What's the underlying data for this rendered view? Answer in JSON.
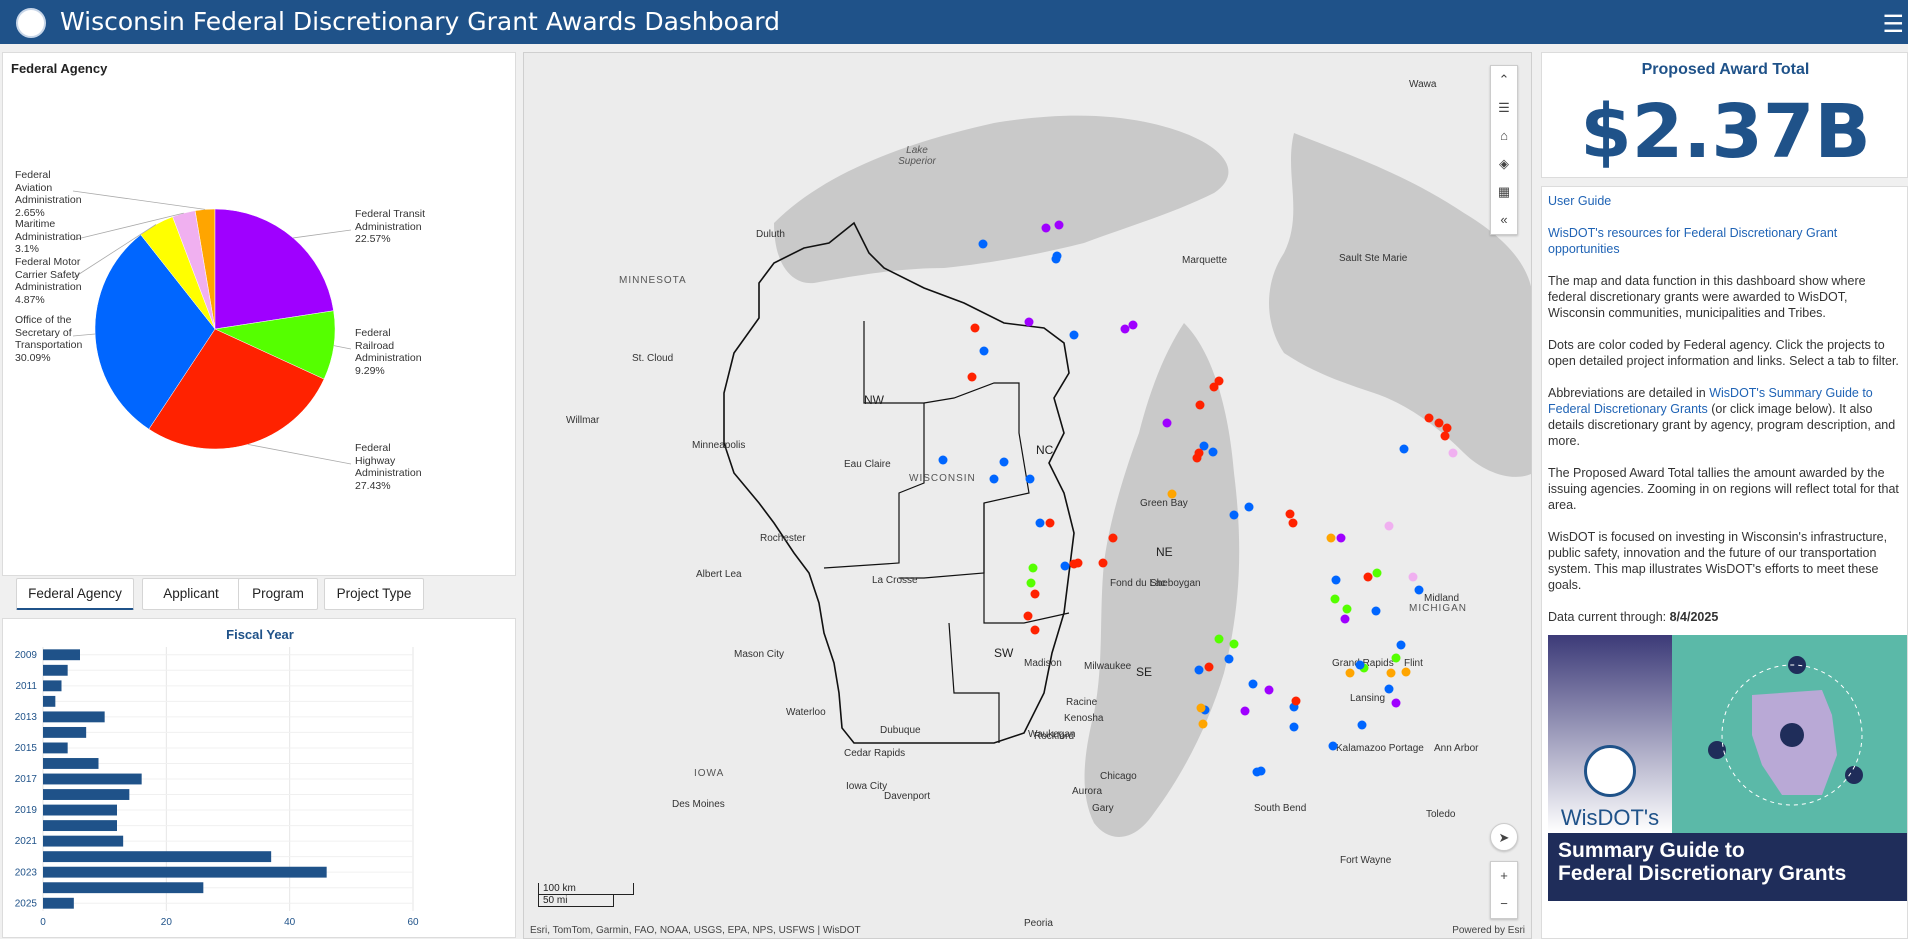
{
  "header": {
    "title": "Wisconsin Federal Discretionary Grant Awards Dashboard"
  },
  "pie": {
    "title": "Federal Agency",
    "slices": [
      {
        "name": "Federal Aviation Administration",
        "label": [
          "Federal",
          "Aviation",
          "Administration",
          "2.65%"
        ],
        "pct": 2.65,
        "color": "#ffa500"
      },
      {
        "name": "Federal Transit Administration",
        "label": [
          "Federal Transit",
          "Administration",
          "22.57%"
        ],
        "pct": 22.57,
        "color": "#9f00ff"
      },
      {
        "name": "Federal Railroad Administration",
        "label": [
          "Federal",
          "Railroad",
          "Administration",
          "9.29%"
        ],
        "pct": 9.29,
        "color": "#55ff00"
      },
      {
        "name": "Federal Highway Administration",
        "label": [
          "Federal",
          "Highway",
          "Administration",
          "27.43%"
        ],
        "pct": 27.43,
        "color": "#ff2200"
      },
      {
        "name": "Office of the Secretary of Transportation",
        "label": [
          "Office of the",
          "Secretary of",
          "Transportation",
          "30.09%"
        ],
        "pct": 30.09,
        "color": "#0066ff"
      },
      {
        "name": "Federal Motor Carrier Safety Administration",
        "label": [
          "Federal Motor",
          "Carrier Safety",
          "Administration",
          "4.87%"
        ],
        "pct": 4.87,
        "color": "#ffff00"
      },
      {
        "name": "Maritime Administration",
        "label": [
          "Maritime",
          "Administration",
          "3.1%"
        ],
        "pct": 3.1,
        "color": "#f0b0f0"
      }
    ]
  },
  "tabs": [
    "Federal Agency",
    "Applicant",
    "Program",
    "Project Type"
  ],
  "bar": {
    "title": "Fiscal Year",
    "years": [
      "2009",
      "2010",
      "2011",
      "2012",
      "2013",
      "2014",
      "2015",
      "2016",
      "2017",
      "2018",
      "2019",
      "2020",
      "2021",
      "2022",
      "2023",
      "2024",
      "2025"
    ],
    "year_labels": [
      "2009",
      "",
      "2011",
      "",
      "2013",
      "",
      "2015",
      "",
      "2017",
      "",
      "2019",
      "",
      "2021",
      "",
      "2023",
      "",
      "2025"
    ],
    "values": [
      6,
      4,
      3,
      2,
      10,
      7,
      4,
      9,
      16,
      14,
      12,
      12,
      13,
      37,
      46,
      26,
      5
    ],
    "xticks": [
      "0",
      "20",
      "40",
      "60"
    ],
    "xmax": 60,
    "color": "#1f5289"
  },
  "chart_data": {
    "type": "bar",
    "title": "Fiscal Year",
    "categories": [
      "2009",
      "2010",
      "2011",
      "2012",
      "2013",
      "2014",
      "2015",
      "2016",
      "2017",
      "2018",
      "2019",
      "2020",
      "2021",
      "2022",
      "2023",
      "2024",
      "2025"
    ],
    "values": [
      6,
      4,
      3,
      2,
      10,
      7,
      4,
      9,
      16,
      14,
      12,
      12,
      13,
      37,
      46,
      26,
      5
    ],
    "xlim": [
      0,
      60
    ],
    "orientation": "horizontal"
  },
  "map": {
    "labels": {
      "lake_superior": "Lake Superior",
      "minnesota": "MINNESOTA",
      "wisconsin": "WISCONSIN",
      "michigan": "MICHIGAN",
      "iowa": "IOWA"
    },
    "regions": [
      "NW",
      "NC",
      "NE",
      "SW",
      "SE"
    ],
    "cities": [
      "Duluth",
      "Minneapolis",
      "St. Cloud",
      "Willmar",
      "Rochester",
      "Albert Lea",
      "Mason City",
      "Waterloo",
      "Cedar Rapids",
      "Iowa City",
      "Des Moines",
      "Davenport",
      "Dubuque",
      "Rockford",
      "Aurora",
      "Chicago",
      "Gary",
      "Waukegan",
      "Kenosha",
      "Racine",
      "Milwaukee",
      "Madison",
      "La Crosse",
      "Eau Claire",
      "Green Bay",
      "Sheboygan",
      "Fond du Lac",
      "Marquette",
      "Sault Ste Marie",
      "Wawa",
      "Grand Rapids",
      "Lansing",
      "Flint",
      "Midland",
      "Kalamazoo Portage",
      "Ann Arbor",
      "South Bend",
      "Fort Wayne",
      "Toledo",
      "Peoria"
    ],
    "scale": {
      "km": "100 km",
      "mi": "50 mi"
    },
    "attribution": "Esri, TomTom, Garmin, FAO, NOAA, USGS, EPA, NPS, USFWS | WisDOT",
    "powered": "Powered by Esri"
  },
  "total": {
    "title": "Proposed Award Total",
    "value": "$2.37B"
  },
  "info": {
    "user_guide": "User Guide",
    "resources": "WisDOT's resources for Federal Discretionary Grant opportunities",
    "p1": "The map and data function in this dashboard show where federal discretionary grants were awarded to WisDOT, Wisconsin communities, municipalities and Tribes.",
    "p2": "Dots are color coded by Federal agency. Click the projects to open detailed project information and links. Select a tab to filter.",
    "p3a": "Abbreviations are detailed in ",
    "p3link": "WisDOT's Summary Guide to Federal Discretionary Grants",
    "p3b": " (or click image below). It also details discretionary grant by agency, program description, and more.",
    "p4": "The Proposed Award Total tallies the amount awarded by the issuing agencies.  Zooming in on regions will reflect total for that area.",
    "p5": "WisDOT is focused on investing in Wisconsin's infrastructure, public safety, innovation and the future of our transportation system. This map illustrates WisDOT's efforts to meet these goals.",
    "current_label": "Data current through: ",
    "current_date": "8/4/2025",
    "guide_brand": "WisDOT's",
    "guide_title1": "Summary Guide to",
    "guide_title2": "Federal Discretionary Grants"
  }
}
